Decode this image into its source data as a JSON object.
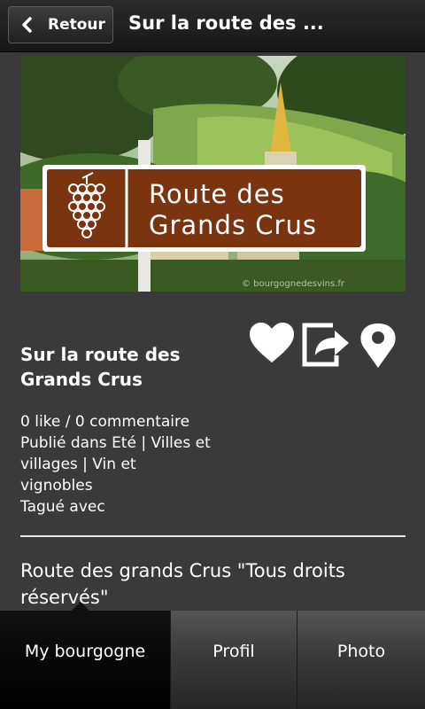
{
  "header": {
    "back_label": "Retour",
    "title": "Sur la route des ..."
  },
  "photo": {
    "sign_line1": "Route des",
    "sign_line2": "Grands Crus",
    "watermark": "© bourgognedesvins.fr"
  },
  "post": {
    "title": "Sur la route des Grands Crus",
    "likes": "0 like / 0 commentaire",
    "published": "Publié dans Eté | Villes et villages | Vin et vignobles",
    "tags": "Tagué avec",
    "body": "Route des grands Crus \"Tous droits réservés\""
  },
  "actions": {
    "like_icon": "heart-icon",
    "share_icon": "share-icon",
    "map_icon": "map-pin-icon"
  },
  "tabs": [
    {
      "label": "My bourgogne",
      "active": true
    },
    {
      "label": "Profil",
      "active": false
    },
    {
      "label": "Photo",
      "active": false
    }
  ],
  "colors": {
    "background": "#3a3a3a",
    "sign_brown": "#7a3410",
    "text": "#ffffff"
  }
}
